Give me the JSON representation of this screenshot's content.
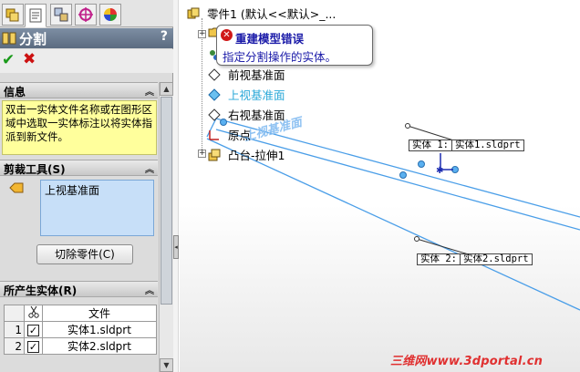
{
  "panel": {
    "title": "分割",
    "help": "?",
    "ok": "✔",
    "cancel": "✖",
    "collapse": "︽",
    "info": {
      "header": "信息",
      "text": "双击一实体文件名称或在图形区域中选取一实体标注以将实体指派到新文件。"
    },
    "trim": {
      "header": "剪裁工具(S)",
      "selected_item": "上视基准面",
      "cut_button": "切除零件(C)"
    },
    "bodies": {
      "header": "所产生实体(R)",
      "column_file": "文件",
      "rows": [
        {
          "num": "1",
          "file": "实体1.sldprt",
          "checked": true
        },
        {
          "num": "2",
          "file": "实体2.sldprt",
          "checked": true
        }
      ]
    },
    "scroll_up": "▲",
    "scroll_down": "▼",
    "splitter_grip": "◂"
  },
  "tree": {
    "root": "零件1 (默认<<默认>_...",
    "plus": "+",
    "items": [
      "前视基准面",
      "上视基准面",
      "右视基准面",
      "原点",
      "凸台-拉伸1"
    ],
    "selected_color": "#2aa8d8"
  },
  "balloon": {
    "title": "重建模型错误",
    "message": "指定分割操作的实体。",
    "icon": "✕"
  },
  "callouts": [
    {
      "label": "实体  1:",
      "file": "实体1.sldprt"
    },
    {
      "label": "实体  2:",
      "file": "实体2.sldprt"
    }
  ],
  "plane_label": "上视基准面",
  "watermark": "三维网www.3dportal.cn",
  "colors": {
    "title_bar": "#6a7a8e",
    "info_bg": "#ffff9c",
    "selection_bg": "#c7dff8",
    "plane_edge": "#4a9ee8",
    "error": "#d01818"
  }
}
